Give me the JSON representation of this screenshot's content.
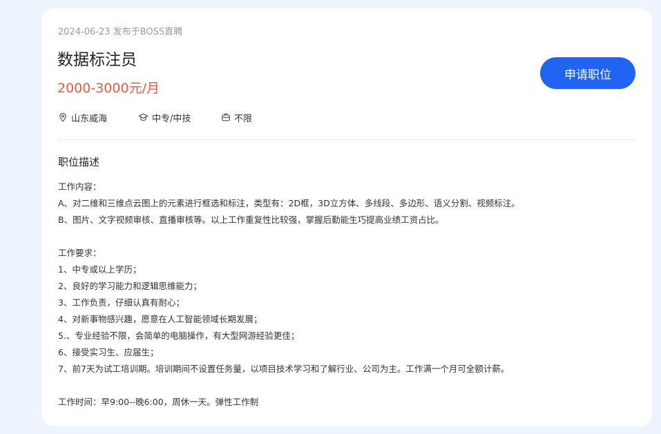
{
  "job": {
    "meta": "2024-06-23 发布于BOSS直聘",
    "title": "数据标注员",
    "salary": "2000-3000元/月",
    "apply_label": "申请职位",
    "location": "山东威海",
    "education": "中专/中技",
    "experience": "不限"
  },
  "description": {
    "section_title": "职位描述",
    "lines": [
      "工作内容：",
      "A、对二维和三维点云图上的元素进行框选和标注，类型有：2D框，3D立方体、多线段、多边形、语义分割、视频标注。",
      "B、图片、文字视频审核、直播审核等。以上工作重复性比较强，掌握后勤能生巧提高业绩工资占比。",
      "",
      "工作要求：",
      "1、中专或以上学历；",
      "2、良好的学习能力和逻辑思维能力；",
      "3、工作负责，仔细认真有耐心；",
      "4、对新事物感兴趣，愿意在人工智能领域长期发展；",
      "5.、专业经验不限，会简单的电脑操作，有大型网游经验更佳；",
      "6、接受实习生、应届生；",
      "7、前7天为试工培训期。培训期间不设置任务量，以项目技术学习和了解行业、公司为主。工作满一个月可全额计薪。",
      "",
      "工作时间：早9:00--晚6:00，周休一天。弹性工作制"
    ]
  },
  "colors": {
    "background": "#eef4fd",
    "accent": "#2164f3",
    "salary": "#ec5a3c"
  },
  "icons": {
    "location": "location-pin-icon",
    "education": "graduation-cap-icon",
    "experience": "briefcase-icon"
  }
}
